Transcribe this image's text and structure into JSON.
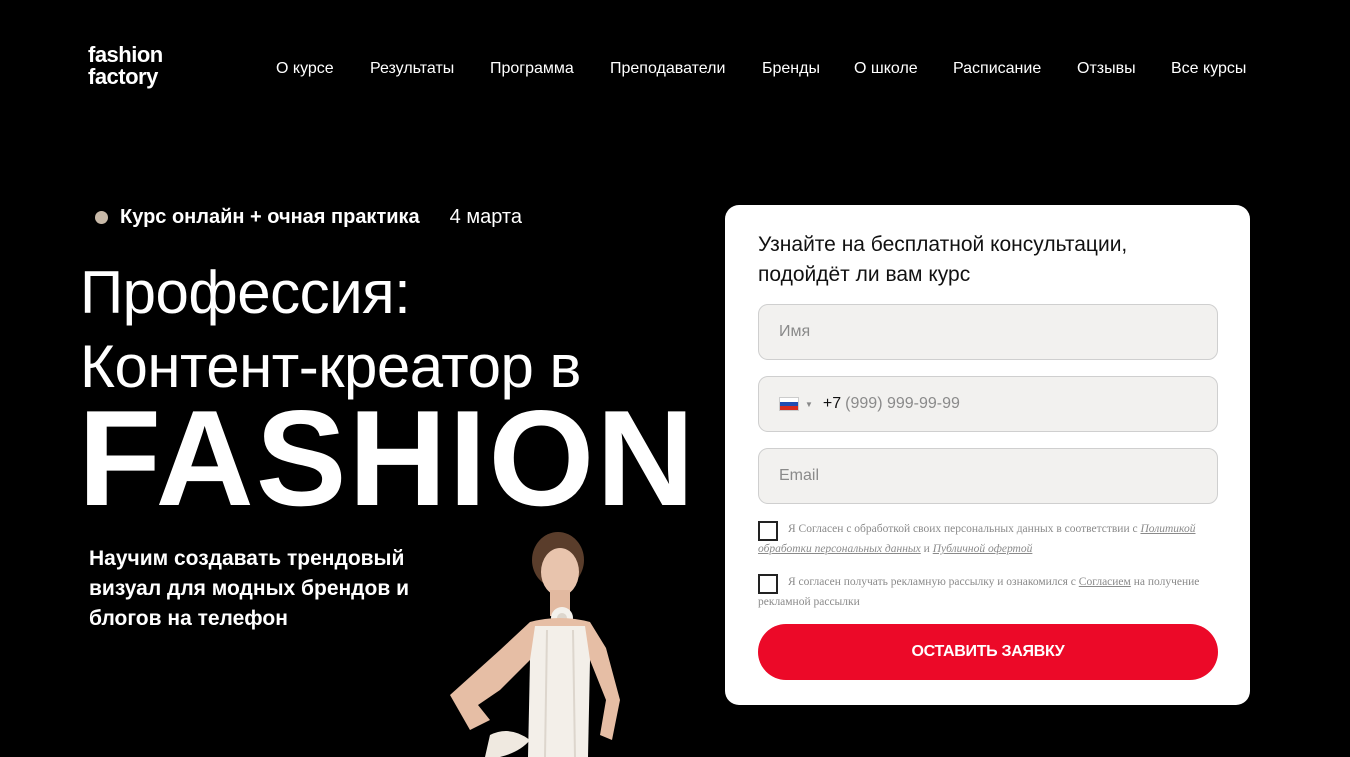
{
  "logo": {
    "line1": "fashion",
    "line2": "factory"
  },
  "nav": [
    {
      "label": "О курсе"
    },
    {
      "label": "Результаты"
    },
    {
      "label": "Программа"
    },
    {
      "label": "Преподаватели"
    },
    {
      "label": "Бренды"
    },
    {
      "label": "О школе"
    },
    {
      "label": "Расписание"
    },
    {
      "label": "Отзывы"
    },
    {
      "label": "Все курсы"
    }
  ],
  "hero": {
    "course_type": "Курс онлайн + очная практика",
    "course_date": "4 марта",
    "title_line1": "Профессия:",
    "title_line2": "Контент-креатор в",
    "title_big": "FASHION",
    "subtitle": "Научим создавать трендовый визуал для модных брендов и блогов на телефон"
  },
  "form": {
    "title": "Узнайте на бесплатной консультации, подойдёт ли вам курс",
    "name_placeholder": "Имя",
    "phone_prefix": "+7",
    "phone_placeholder": "(999) 999-99-99",
    "email_placeholder": "Email",
    "consent1": {
      "text_before": "Я Согласен с обработкой своих персональных данных в соответствии с ",
      "link1": "Политикой обработки персональных данных",
      "between": " и ",
      "link2": "Публичной офертой"
    },
    "consent2": {
      "text_before": "Я согласен получать рекламную рассылку и ознакомился с ",
      "link": "Согласием",
      "text_after": " на получение рекламной рассылки"
    },
    "submit_label": "ОСТАВИТЬ ЗАЯВКУ"
  },
  "colors": {
    "background": "#000000",
    "accent": "#ec0928",
    "card": "#ffffff",
    "field_bg": "#f2f1ef",
    "dot": "#c8b9a8"
  },
  "icons": [
    "russia-flag-icon",
    "chevron-down-icon",
    "checkbox-icon"
  ]
}
